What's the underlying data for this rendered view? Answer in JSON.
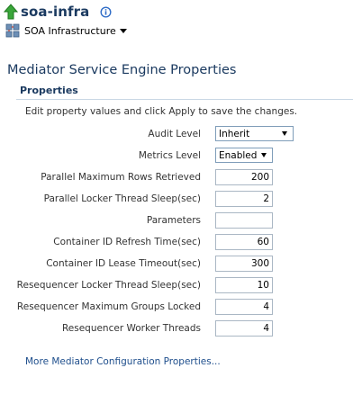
{
  "header": {
    "target_name": "soa-infra",
    "menu_label": "SOA Infrastructure"
  },
  "page": {
    "title": "Mediator Service Engine Properties",
    "section_title": "Properties",
    "instructions": "Edit property values and click Apply to save the changes."
  },
  "fields": {
    "audit_level": {
      "label": "Audit Level",
      "value": "Inherit"
    },
    "metrics_level": {
      "label": "Metrics Level",
      "value": "Enabled"
    },
    "parallel_max_rows": {
      "label": "Parallel Maximum Rows Retrieved",
      "value": "200"
    },
    "parallel_locker_sleep": {
      "label": "Parallel Locker Thread Sleep(sec)",
      "value": "2"
    },
    "parameters": {
      "label": "Parameters",
      "value": ""
    },
    "container_refresh": {
      "label": "Container ID Refresh Time(sec)",
      "value": "60"
    },
    "container_lease": {
      "label": "Container ID Lease Timeout(sec)",
      "value": "300"
    },
    "reseq_locker_sleep": {
      "label": "Resequencer Locker Thread Sleep(sec)",
      "value": "10"
    },
    "reseq_max_groups": {
      "label": "Resequencer Maximum Groups Locked",
      "value": "4"
    },
    "reseq_worker_threads": {
      "label": "Resequencer Worker Threads",
      "value": "4"
    }
  },
  "links": {
    "more_config": "More Mediator Configuration Properties..."
  }
}
